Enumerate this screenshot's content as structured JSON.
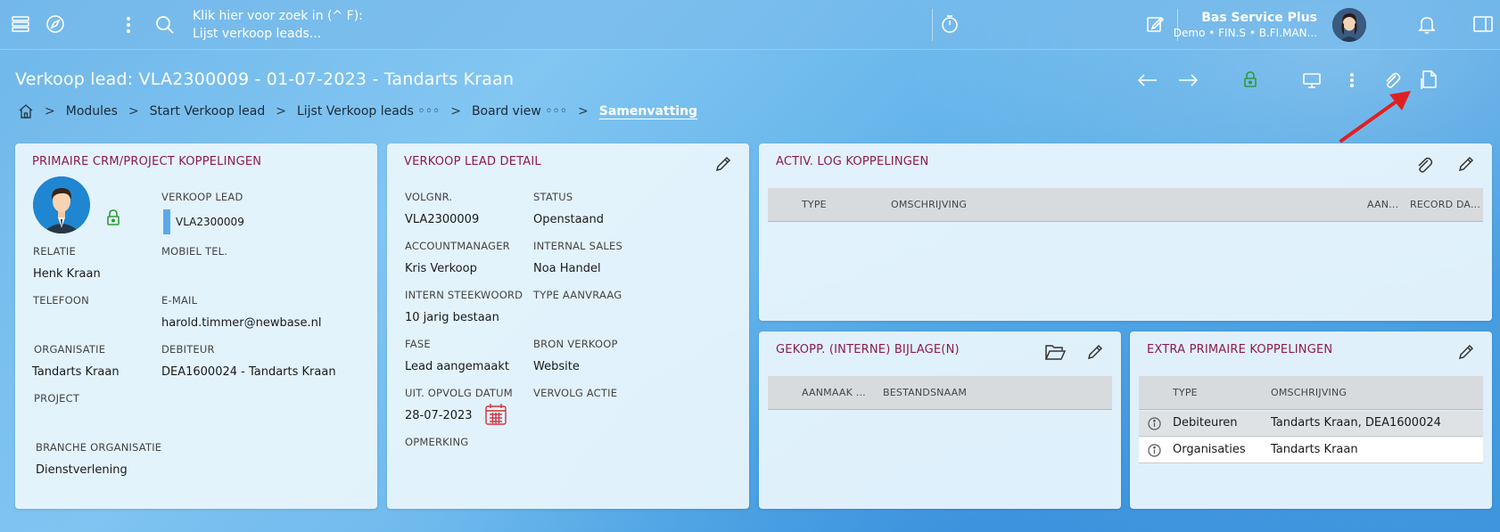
{
  "topbar": {
    "search_line1": "Klik hier voor zoek in (^ F):",
    "search_line2": "Lijst verkoop leads...",
    "user_name": "Bas Service Plus",
    "user_sub": "Demo • FIN.S • B.FI.MAN...",
    "icons": [
      "menu-icon",
      "compass-icon",
      "more-vertical-icon",
      "search-icon",
      "timer-icon",
      "edit-note-icon",
      "bell-icon",
      "panel-icon"
    ]
  },
  "page": {
    "title": "Verkoop lead: VLA2300009 - 01-07-2023 - Tandarts Kraan"
  },
  "breadcrumb": {
    "items": [
      "Modules",
      "Start Verkoop lead",
      "Lijst Verkoop leads ◦◦◦",
      "Board view ◦◦◦",
      "Samenvatting"
    ]
  },
  "crm": {
    "title": "PRIMAIRE CRM/PROJECT KOPPELINGEN",
    "verkoop_lead_label": "VERKOOP LEAD",
    "verkoop_lead_value": "VLA2300009",
    "relatie_label": "RELATIE",
    "relatie_value": "Henk Kraan",
    "mobiel_label": "MOBIEL TEL.",
    "telefoon_label": "TELEFOON",
    "email_label": "E-MAIL",
    "email_value": "harold.timmer@newbase.nl",
    "organisatie_label": "ORGANISATIE",
    "organisatie_value": "Tandarts Kraan",
    "debiteur_label": "DEBITEUR",
    "debiteur_value": "DEA1600024 - Tandarts Kraan",
    "project_label": "PROJECT",
    "branche_label": "BRANCHE ORGANISATIE",
    "branche_value": "Dienstverlening"
  },
  "detail": {
    "title": "VERKOOP LEAD DETAIL",
    "volgnr_label": "VOLGNR.",
    "volgnr_value": "VLA2300009",
    "status_label": "STATUS",
    "status_value": "Openstaand",
    "accountmanager_label": "ACCOUNTMANAGER",
    "accountmanager_value": "Kris Verkoop",
    "internal_sales_label": "INTERNAL SALES",
    "internal_sales_value": "Noa Handel",
    "steekwoord_label": "INTERN STEEKWOORD",
    "steekwoord_value": "10 jarig bestaan",
    "type_aanvraag_label": "TYPE AANVRAAG",
    "fase_label": "FASE",
    "fase_value": "Lead aangemaakt",
    "bron_label": "BRON VERKOOP",
    "bron_value": "Website",
    "opvolg_label": "UIT. OPVOLG DATUM",
    "opvolg_value": "28-07-2023",
    "vervolg_label": "VERVOLG ACTIE",
    "opmerking_label": "OPMERKING"
  },
  "activ": {
    "title": "ACTIV. LOG KOPPELINGEN",
    "columns": [
      "TYPE",
      "OMSCHRIJVING",
      "AAN...",
      "RECORD DA..."
    ]
  },
  "bijlage": {
    "title": "GEKOPP. (INTERNE) BIJLAGE(N)",
    "columns": [
      "AANMAAK ...",
      "BESTANDSNAAM"
    ]
  },
  "extra": {
    "title": "EXTRA PRIMAIRE KOPPELINGEN",
    "columns": [
      "TYPE",
      "OMSCHRIJVING"
    ],
    "rows": [
      {
        "type": "Debiteuren",
        "omschrijving": "Tandarts Kraan, DEA1600024"
      },
      {
        "type": "Organisaties",
        "omschrijving": "Tandarts Kraan"
      }
    ]
  },
  "colors": {
    "accent_title": "#8c1b4e",
    "arrow": "#e02020",
    "lock_green": "#2e9a3a",
    "calendar_red": "#d2323c"
  }
}
